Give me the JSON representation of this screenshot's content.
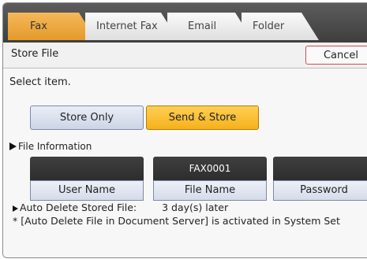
{
  "tabs": [
    {
      "label": "Fax",
      "active": true
    },
    {
      "label": "Internet Fax",
      "active": false
    },
    {
      "label": "Email",
      "active": false
    },
    {
      "label": "Folder",
      "active": false
    }
  ],
  "header": {
    "title": "Store File",
    "cancel_label": "Cancel"
  },
  "instruction": "Select item.",
  "options": {
    "store_only": "Store Only",
    "send_store": "Send & Store"
  },
  "file_info": {
    "label": "File Information",
    "user_name": {
      "value": "",
      "label": "User Name"
    },
    "file_name": {
      "value": "FAX0001",
      "label": "File Name"
    },
    "password": {
      "value": "",
      "label": "Password"
    }
  },
  "auto_delete": {
    "label": "Auto Delete Stored File:",
    "value": "3 day(s) later",
    "note": "* [Auto Delete File in Document Server] is activated in System Set"
  },
  "colors": {
    "selected": "#f5b11c",
    "tab_active": "#e39a2b",
    "cancel_border": "#d74a4a"
  }
}
